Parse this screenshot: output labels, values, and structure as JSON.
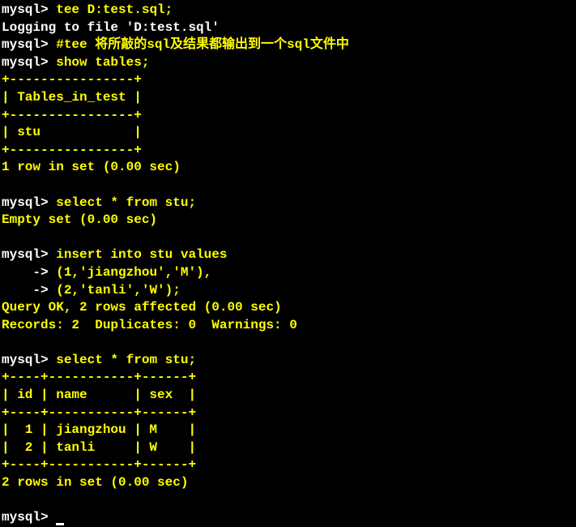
{
  "terminal": {
    "line1_prompt": "mysql> ",
    "line1_cmd": "tee D:test.sql;",
    "line2": "Logging to file 'D:test.sql'",
    "line3_prompt": "mysql> ",
    "line3_cmd": "#tee 将所敲的sql及结果都输出到一个sql文件中",
    "line4_prompt": "mysql> ",
    "line4_cmd": "show tables;",
    "line5": "+----------------+",
    "line6": "| Tables_in_test |",
    "line7": "+----------------+",
    "line8": "| stu            |",
    "line9": "+----------------+",
    "line10": "1 row in set (0.00 sec)",
    "blank1": " ",
    "line11_prompt": "mysql> ",
    "line11_cmd": "select * from stu;",
    "line12": "Empty set (0.00 sec)",
    "blank2": " ",
    "line13_prompt": "mysql> ",
    "line13_cmd": "insert into stu values",
    "line14_prompt": "    -> ",
    "line14_cmd": "(1,'jiangzhou','M'),",
    "line15_prompt": "    -> ",
    "line15_cmd": "(2,'tanli','W');",
    "line16": "Query OK, 2 rows affected (0.00 sec)",
    "line17": "Records: 2  Duplicates: 0  Warnings: 0",
    "blank3": " ",
    "line18_prompt": "mysql> ",
    "line18_cmd": "select * from stu;",
    "line19": "+----+-----------+------+",
    "line20": "| id | name      | sex  |",
    "line21": "+----+-----------+------+",
    "line22": "|  1 | jiangzhou | M    |",
    "line23": "|  2 | tanli     | W    |",
    "line24": "+----+-----------+------+",
    "line25": "2 rows in set (0.00 sec)",
    "blank4": " ",
    "line26_prompt": "mysql> "
  },
  "chart_data": {
    "type": "table",
    "tables_in_test": [
      "stu"
    ],
    "stu_columns": [
      "id",
      "name",
      "sex"
    ],
    "stu_rows": [
      {
        "id": 1,
        "name": "jiangzhou",
        "sex": "M"
      },
      {
        "id": 2,
        "name": "tanli",
        "sex": "W"
      }
    ]
  }
}
